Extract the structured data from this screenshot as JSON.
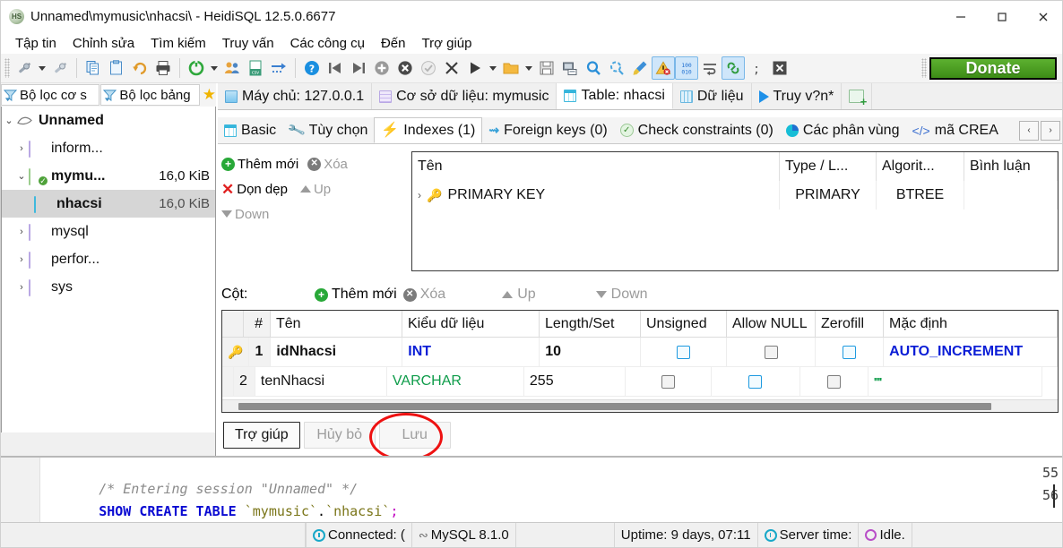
{
  "window": {
    "title": "Unnamed\\mymusic\\nhacsi\\ - HeidiSQL 12.5.0.6677",
    "app_icon": "HS",
    "minimize": "–",
    "maximize": "▫",
    "close": "✕"
  },
  "menu": {
    "items": [
      {
        "label": "Tập tin"
      },
      {
        "label": "Chỉnh sửa"
      },
      {
        "label": "Tìm kiếm"
      },
      {
        "label": "Truy vấn"
      },
      {
        "label": "Các công cụ"
      },
      {
        "label": "Đến"
      },
      {
        "label": "Trợ giúp"
      }
    ]
  },
  "toolbar": {
    "donate_label": "Donate",
    "buttons": [
      {
        "name": "session-manager-icon",
        "glyph": "✂"
      },
      {
        "name": "session-manager-dropdown-icon",
        "glyph": ""
      },
      {
        "name": "new-session-icon",
        "glyph": "✂"
      },
      {
        "name": "sep1",
        "glyph": ""
      },
      {
        "name": "copy-icon",
        "glyph": "⧉"
      },
      {
        "name": "paste-icon",
        "glyph": "⎘"
      },
      {
        "name": "undo-icon",
        "glyph": "↶"
      },
      {
        "name": "print-icon",
        "glyph": "⎙"
      },
      {
        "name": "sep2",
        "glyph": ""
      },
      {
        "name": "refresh-icon",
        "glyph": "⟳"
      },
      {
        "name": "refresh-dropdown-icon",
        "glyph": ""
      },
      {
        "name": "user-manager-icon",
        "glyph": "👥"
      },
      {
        "name": "export-csv-icon",
        "glyph": "csv"
      },
      {
        "name": "import-icon",
        "glyph": "→"
      },
      {
        "name": "sep3",
        "glyph": ""
      },
      {
        "name": "help-icon",
        "glyph": "?"
      },
      {
        "name": "first-record-icon",
        "glyph": "⏮"
      },
      {
        "name": "last-record-icon",
        "glyph": "⏭"
      },
      {
        "name": "insert-record-icon",
        "glyph": "+"
      },
      {
        "name": "delete-record-icon",
        "glyph": "✕"
      },
      {
        "name": "post-changes-icon",
        "glyph": "✓"
      },
      {
        "name": "cancel-changes-icon",
        "glyph": "✕"
      },
      {
        "name": "execute-query-icon",
        "glyph": "▶"
      },
      {
        "name": "execute-dropdown-icon",
        "glyph": ""
      },
      {
        "name": "load-sql-icon",
        "glyph": "📁"
      },
      {
        "name": "load-sql-dropdown-icon",
        "glyph": ""
      },
      {
        "name": "save-sql-icon",
        "glyph": "💾"
      },
      {
        "name": "save-sql-as-icon",
        "glyph": "🖫"
      },
      {
        "name": "find-icon",
        "glyph": "🔍"
      },
      {
        "name": "replace-icon",
        "glyph": "⟳"
      },
      {
        "name": "format-sql-icon",
        "glyph": "🧹"
      },
      {
        "name": "warning-icon",
        "glyph": "⚠"
      },
      {
        "name": "binary-view-icon",
        "glyph": "100"
      },
      {
        "name": "word-wrap-icon",
        "glyph": "↵"
      },
      {
        "name": "link-icon",
        "glyph": "🔗"
      },
      {
        "name": "semicolon-icon",
        "glyph": ";"
      },
      {
        "name": "stop-icon",
        "glyph": "✕"
      }
    ]
  },
  "sidebar": {
    "filter_database": "Bộ lọc cơ s",
    "filter_table": "Bộ lọc bảng",
    "favorites_icon": "★",
    "tree": [
      {
        "label": "Unnamed",
        "size": "",
        "level": 0,
        "expander": "⌄",
        "icon": "connection",
        "bold": true,
        "selected": false
      },
      {
        "label": "inform...",
        "size": "",
        "level": 1,
        "expander": "›",
        "icon": "database",
        "bold": false,
        "selected": false
      },
      {
        "label": "mymu...",
        "size": "16,0 KiB",
        "level": 1,
        "expander": "⌄",
        "icon": "database-active",
        "bold": true,
        "selected": false
      },
      {
        "label": "nhacsi",
        "size": "16,0 KiB",
        "level": 2,
        "expander": "",
        "icon": "table",
        "bold": true,
        "selected": true
      },
      {
        "label": "mysql",
        "size": "",
        "level": 1,
        "expander": "›",
        "icon": "database",
        "bold": false,
        "selected": false
      },
      {
        "label": "perfor...",
        "size": "",
        "level": 1,
        "expander": "›",
        "icon": "database",
        "bold": false,
        "selected": false
      },
      {
        "label": "sys",
        "size": "",
        "level": 1,
        "expander": "›",
        "icon": "database",
        "bold": false,
        "selected": false
      }
    ]
  },
  "main_tabs": [
    {
      "label": "Máy chủ: 127.0.0.1",
      "icon": "server-icon",
      "active": false
    },
    {
      "label": "Cơ sở dữ liệu: mymusic",
      "icon": "database-icon",
      "active": false
    },
    {
      "label": "Table: nhacsi",
      "icon": "table-icon",
      "active": true
    },
    {
      "label": "Dữ liệu",
      "icon": "grid-icon",
      "active": false
    },
    {
      "label": "Truy v?n*",
      "icon": "play-icon",
      "active": false
    },
    {
      "label": "",
      "icon": "new-query-tab-icon",
      "active": false
    }
  ],
  "sub_tabs": [
    {
      "label": "Basic",
      "icon": "table-basic-icon",
      "active": false
    },
    {
      "label": "Tùy chọn",
      "icon": "wrench-icon",
      "active": false
    },
    {
      "label": "Indexes (1)",
      "icon": "bolt-icon",
      "active": true
    },
    {
      "label": "Foreign keys (0)",
      "icon": "foreign-key-icon",
      "active": false
    },
    {
      "label": "Check constraints (0)",
      "icon": "check-circle-icon",
      "active": false
    },
    {
      "label": "Các phân vùng",
      "icon": "pie-icon",
      "active": false
    },
    {
      "label": "mã CREA",
      "icon": "code-icon",
      "active": false
    }
  ],
  "sub_tab_scroll": {
    "left": "‹",
    "right": "›"
  },
  "indexes_panel": {
    "actions": [
      {
        "label": "Thêm mới",
        "icon": "add-icon",
        "disabled": false
      },
      {
        "label": "Xóa",
        "icon": "remove-icon",
        "disabled": true
      },
      {
        "label": "Dọn dẹp",
        "icon": "clear-icon",
        "disabled": false
      },
      {
        "label": "Up",
        "icon": "move-up-icon",
        "disabled": true
      },
      {
        "label": "Down",
        "icon": "move-down-icon",
        "disabled": true
      }
    ],
    "columns": [
      "Tên",
      "Type / L...",
      "Algorit...",
      "Bình luận"
    ],
    "rows": [
      {
        "expander": "›",
        "icon": "key-icon",
        "name": "PRIMARY KEY",
        "type": "PRIMARY",
        "algorithm": "BTREE",
        "comment": ""
      }
    ]
  },
  "columns_panel": {
    "title": "Cột:",
    "actions": [
      {
        "label": "Thêm mới",
        "icon": "add-icon",
        "disabled": false
      },
      {
        "label": "Xóa",
        "icon": "remove-icon",
        "disabled": true
      },
      {
        "label": "Up",
        "icon": "move-up-icon",
        "disabled": true
      },
      {
        "label": "Down",
        "icon": "move-down-icon",
        "disabled": true
      }
    ],
    "columns": [
      "",
      "#",
      "Tên",
      "Kiểu dữ liệu",
      "Length/Set",
      "Unsigned",
      "Allow NULL",
      "Zerofill",
      "Mặc định"
    ],
    "rows": [
      {
        "key": "key-icon",
        "num": "1",
        "name": "idNhacsi",
        "datatype": "INT",
        "datatype_kind": "int",
        "length": "10",
        "unsigned": false,
        "unsigned_style": "blue",
        "allow_null": false,
        "allow_null_style": "gray",
        "zerofill": false,
        "zerofill_style": "blue",
        "default": "AUTO_INCREMENT",
        "default_kind": "auto",
        "bold": true
      },
      {
        "key": "",
        "num": "2",
        "name": "tenNhacsi",
        "datatype": "VARCHAR",
        "datatype_kind": "varchar",
        "length": "255",
        "unsigned": false,
        "unsigned_style": "gray",
        "allow_null": false,
        "allow_null_style": "blue",
        "zerofill": false,
        "zerofill_style": "gray",
        "default": "''''",
        "default_kind": "empty",
        "bold": false
      }
    ]
  },
  "form_buttons": [
    {
      "label": "Trợ giúp",
      "state": "focused"
    },
    {
      "label": "Hủy bỏ",
      "state": "disabled"
    },
    {
      "label": "Lưu",
      "state": "disabled"
    }
  ],
  "sql_log": {
    "lines": [
      {
        "number": "55",
        "segments": [
          {
            "text": "/* Entering session \"Unnamed\" */",
            "kind": "comment"
          }
        ]
      },
      {
        "number": "56",
        "segments": [
          {
            "text": "SHOW CREATE TABLE ",
            "kind": "keyword"
          },
          {
            "text": "`mymusic`",
            "kind": "identifier"
          },
          {
            "text": ".",
            "kind": "plain"
          },
          {
            "text": "`nhacsi`",
            "kind": "identifier"
          },
          {
            "text": ";",
            "kind": "punct"
          }
        ]
      }
    ]
  },
  "status_bar": [
    {
      "label": "Connected: (",
      "icon": "clock-icon"
    },
    {
      "label": "MySQL 8.1.0",
      "icon": "dolphin-icon"
    },
    {
      "label": "Uptime: 9 days, 07:11",
      "icon": ""
    },
    {
      "label": "Server time:",
      "icon": "clock-icon"
    },
    {
      "label": "Idle.",
      "icon": "idle-icon"
    }
  ],
  "colors": {
    "accent_blue": "#0b1ed6",
    "green": "#0e9c4a",
    "donate_green": "#3d8c16",
    "highlight_red": "#ee1111",
    "selection_gray": "#d6d6d6"
  }
}
